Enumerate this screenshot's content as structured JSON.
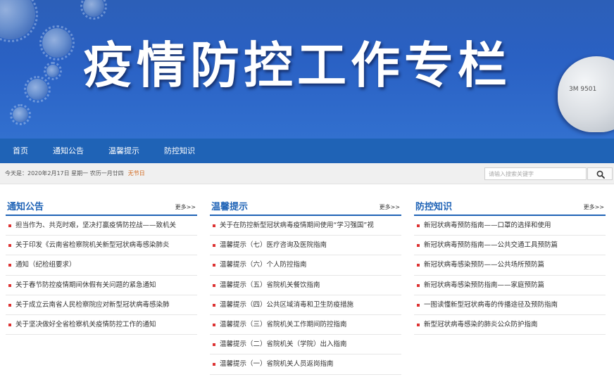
{
  "banner": {
    "title": "疫情防控工作专栏",
    "mask_label": "3M 9501"
  },
  "nav": {
    "items": [
      "首页",
      "通知公告",
      "温馨提示",
      "防控知识"
    ]
  },
  "infobar": {
    "date_text": "今天是：2020年2月17日 星期一   农历一月廿四",
    "holiday": "无节日",
    "search_placeholder": "请输入搜索关键字"
  },
  "columns": [
    {
      "title": "通知公告",
      "more": "更多>>",
      "items": [
        "担当作为、共克时艰，坚决打赢疫情防控战——致机关",
        "关于印发《云南省检察院机关新型冠状病毒感染肺炎",
        "通知（纪检组要求）",
        "关于春节防控疫情期间休假有关问题的紧急通知",
        "关于成立云南省人民检察院应对新型冠状病毒感染肺",
        "关于坚决做好全省检察机关疫情防控工作的通知"
      ]
    },
    {
      "title": "温馨提示",
      "more": "更多>>",
      "items": [
        "关于在防控新型冠状病毒疫情期间使用“学习强国”视",
        "温馨提示（七）医疗咨询及医院指南",
        "温馨提示（六）个人防控指南",
        "温馨提示（五）省院机关餐饮指南",
        "温馨提示（四）公共区域消毒和卫生防疫措施",
        "温馨提示（三）省院机关工作期间防控指南",
        "温馨提示（二）省院机关（学院）出入指南",
        "温馨提示（一）省院机关人员返岗指南"
      ]
    },
    {
      "title": "防控知识",
      "more": "更多>>",
      "items": [
        "新冠状病毒预防指南——口罩的选择和使用",
        "新冠状病毒预防指南——公共交通工具预防篇",
        "新冠状病毒感染预防——公共场所预防篇",
        "新冠状病毒感染预防指南——家庭预防篇",
        "一图读懂新型冠状病毒的传播途径及预防指南",
        "新型冠状病毒感染的肺炎公众防护指南"
      ]
    }
  ],
  "colors": {
    "primary": "#1f63b6",
    "bullet": "#dd3333",
    "holiday": "#d2691e"
  }
}
